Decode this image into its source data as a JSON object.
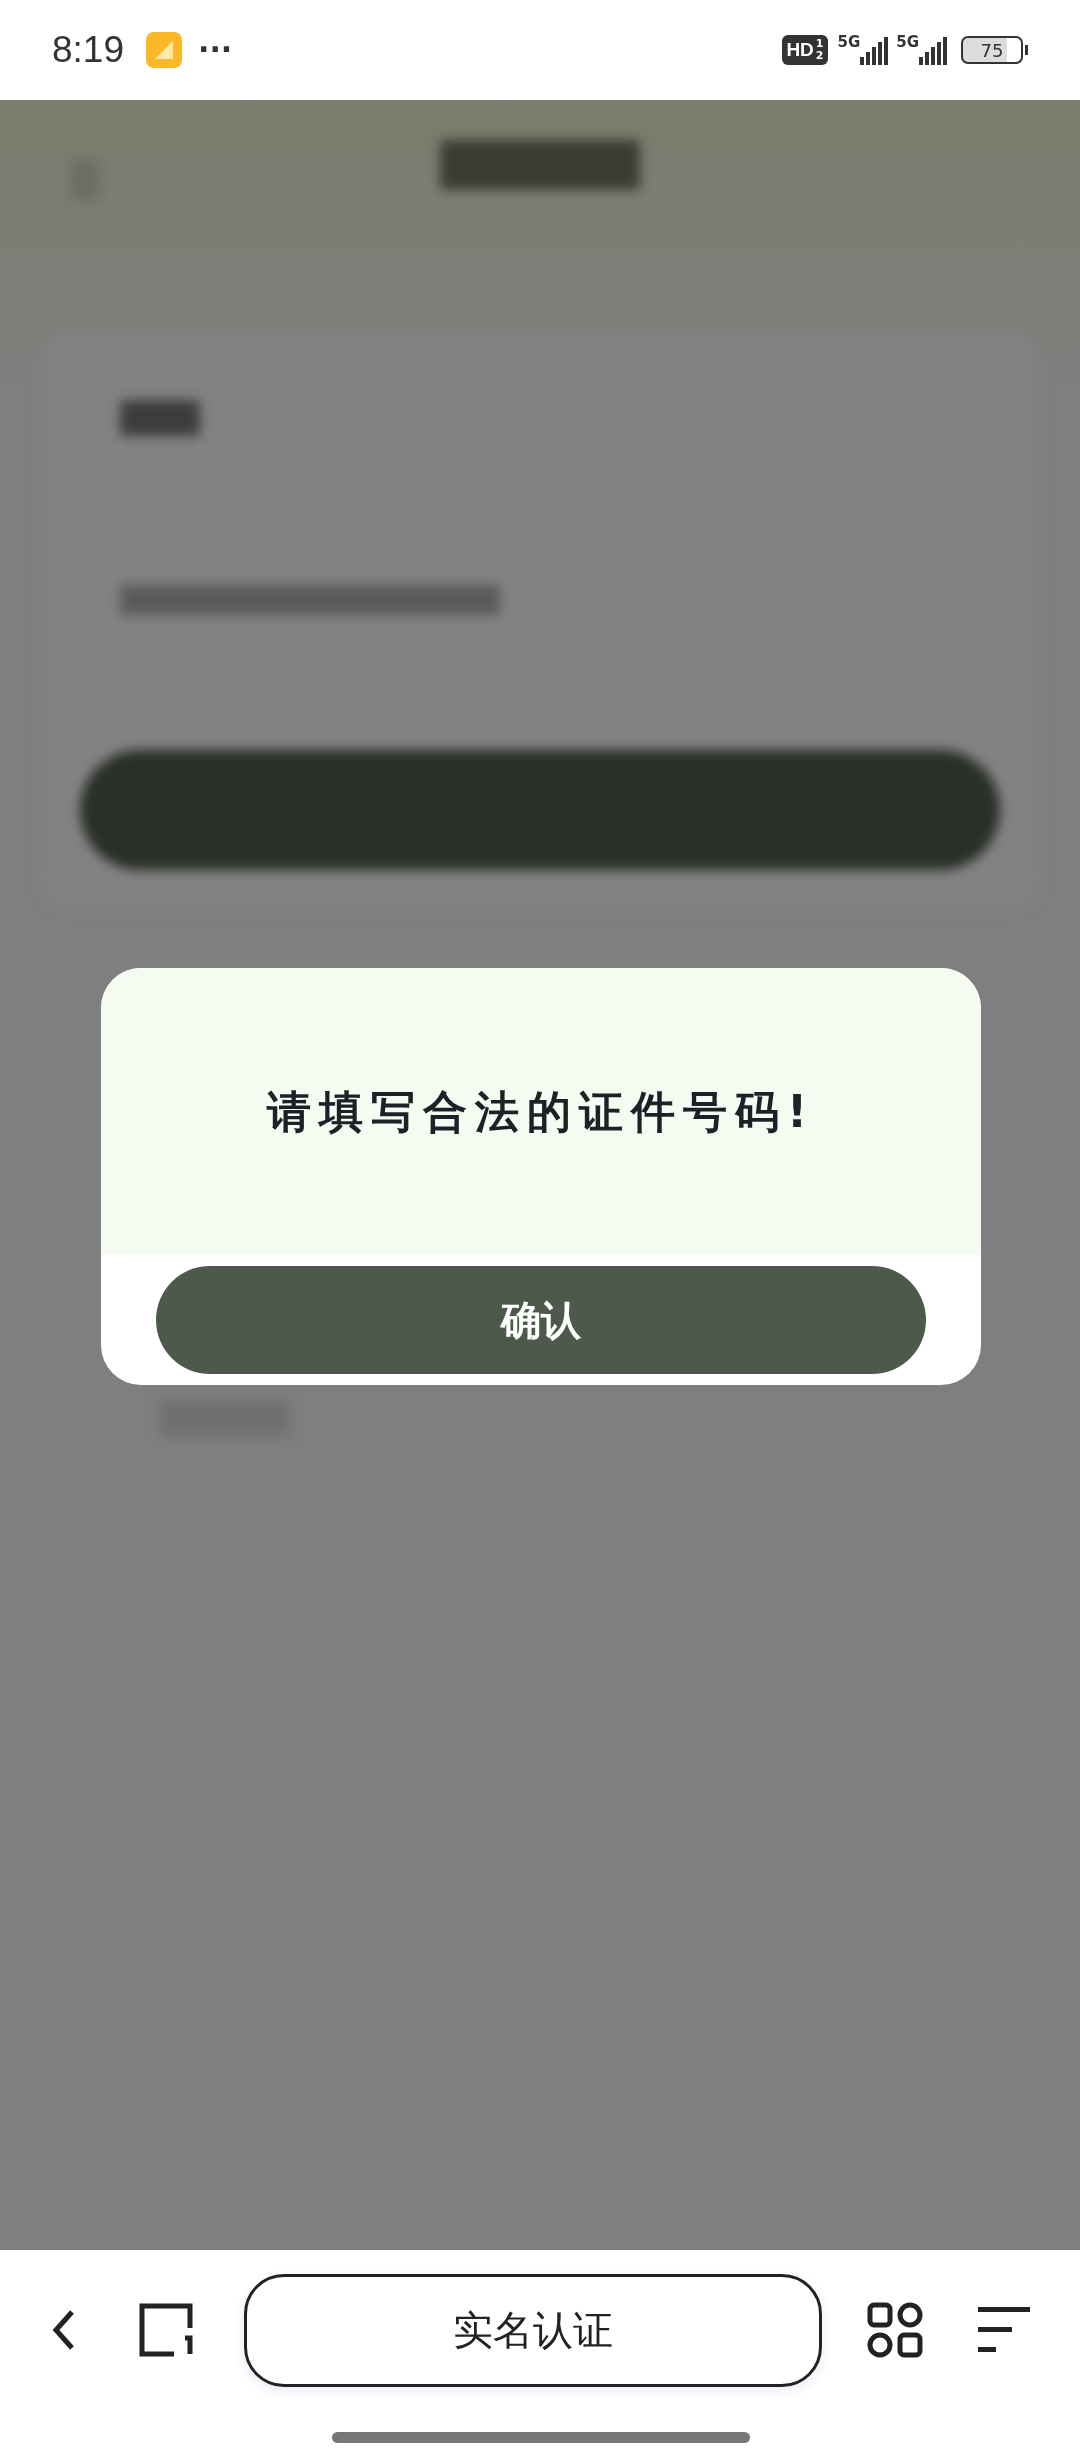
{
  "status_bar": {
    "time": "8:19",
    "more": "···",
    "hd": "HD",
    "hd_sup": "1",
    "hd_sub": "2",
    "network_1": "5G",
    "network_2": "5G",
    "battery": "75"
  },
  "dialog": {
    "message": "请填写合法的证件号码!",
    "confirm_button": "确认"
  },
  "browser_bar": {
    "address": "实名认证"
  }
}
